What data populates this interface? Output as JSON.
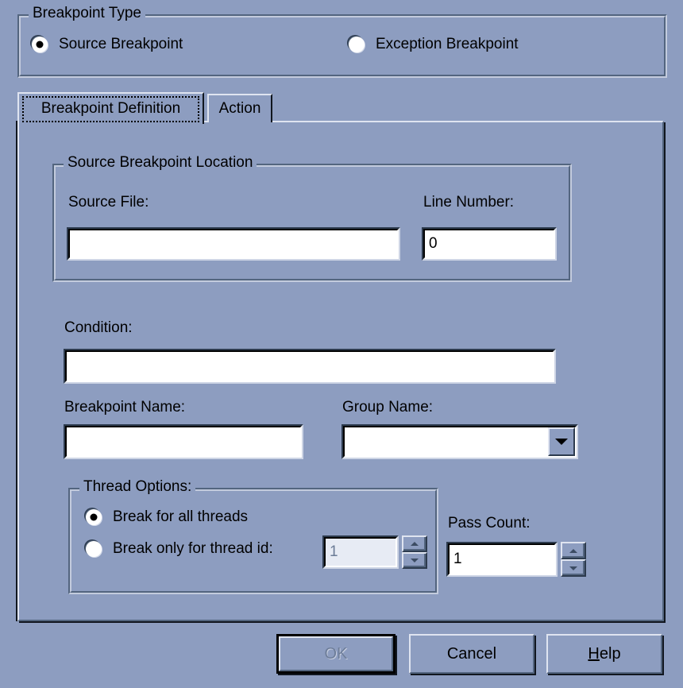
{
  "breakpoint_type": {
    "legend": "Breakpoint Type",
    "options": [
      {
        "label": "Source Breakpoint",
        "checked": true
      },
      {
        "label": "Exception Breakpoint",
        "checked": false
      }
    ]
  },
  "tabs": [
    {
      "label": "Breakpoint Definition",
      "selected": true
    },
    {
      "label": "Action",
      "selected": false
    }
  ],
  "source_location": {
    "legend": "Source Breakpoint Location",
    "source_file_label": "Source File:",
    "source_file_value": "",
    "line_number_label": "Line Number:",
    "line_number_value": "0"
  },
  "condition": {
    "label": "Condition:",
    "value": ""
  },
  "breakpoint_name": {
    "label": "Breakpoint Name:",
    "value": ""
  },
  "group_name": {
    "label": "Group Name:",
    "value": "",
    "dropdown_icon": "chevron-down-icon"
  },
  "thread_options": {
    "legend": "Thread Options:",
    "all_threads_label": "Break for all threads",
    "all_threads_checked": true,
    "thread_id_label": "Break only for thread id:",
    "thread_id_checked": false,
    "thread_id_value": "1",
    "thread_id_disabled": true
  },
  "pass_count": {
    "label": "Pass Count:",
    "value": "1"
  },
  "buttons": {
    "ok": {
      "label": "OK",
      "disabled": true,
      "is_default": true
    },
    "cancel": {
      "label": "Cancel",
      "disabled": false
    },
    "help": {
      "label": "Help",
      "accelerator": "H",
      "disabled": false
    }
  },
  "colors": {
    "dialog_face": "#8d9dc0",
    "shadow_dark": "#53657f",
    "highlight_light": "#dfe4f0",
    "field_white": "#ffffff",
    "disabled_text": "#6b7b96"
  }
}
